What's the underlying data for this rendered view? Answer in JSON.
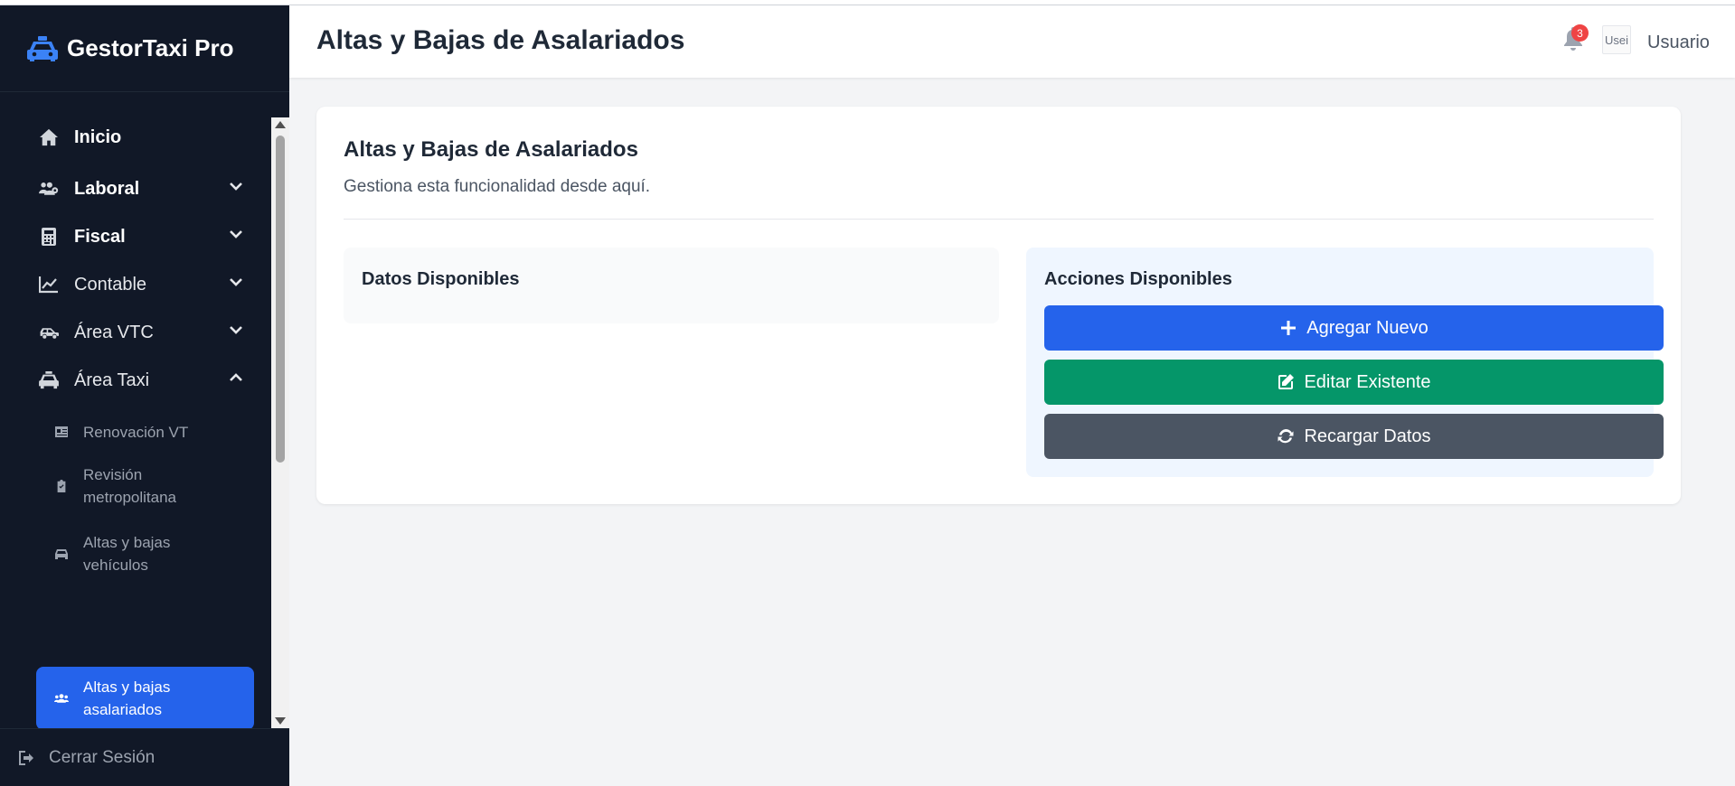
{
  "app": {
    "name": "GestorTaxi Pro"
  },
  "header": {
    "title": "Altas y Bajas de Asalariados",
    "notification_count": "3",
    "avatar_alt": "Usei",
    "user_name": "Usuario"
  },
  "sidebar": {
    "items": [
      {
        "label": "Inicio",
        "icon": "home-icon"
      },
      {
        "label": "Laboral",
        "icon": "users-cog-icon"
      },
      {
        "label": "Fiscal",
        "icon": "calculator-icon"
      },
      {
        "label": "Contable",
        "icon": "chart-line-icon"
      },
      {
        "label": "Área VTC",
        "icon": "car-side-icon"
      },
      {
        "label": "Área Taxi",
        "icon": "taxi-icon"
      }
    ],
    "sub_items": [
      {
        "label": "Renovación VT",
        "icon": "id-card-icon"
      },
      {
        "label": "Revisión metropolitana",
        "icon": "clipboard-check-icon"
      },
      {
        "label": "Altas y bajas vehículos",
        "icon": "car-icon"
      },
      {
        "label": "Altas y bajas asalariados",
        "icon": "users-icon",
        "active": true
      }
    ],
    "logout_label": "Cerrar Sesión"
  },
  "main": {
    "card_title": "Altas y Bajas de Asalariados",
    "card_subtitle": "Gestiona esta funcionalidad desde aquí.",
    "data_panel_title": "Datos Disponibles",
    "actions_panel_title": "Acciones Disponibles",
    "actions": {
      "add": "Agregar Nuevo",
      "edit": "Editar Existente",
      "reload": "Recargar Datos"
    }
  },
  "colors": {
    "sidebar_bg": "#111827",
    "accent": "#2563eb",
    "success": "#059669",
    "neutral": "#4b5563",
    "badge": "#ef4444"
  }
}
